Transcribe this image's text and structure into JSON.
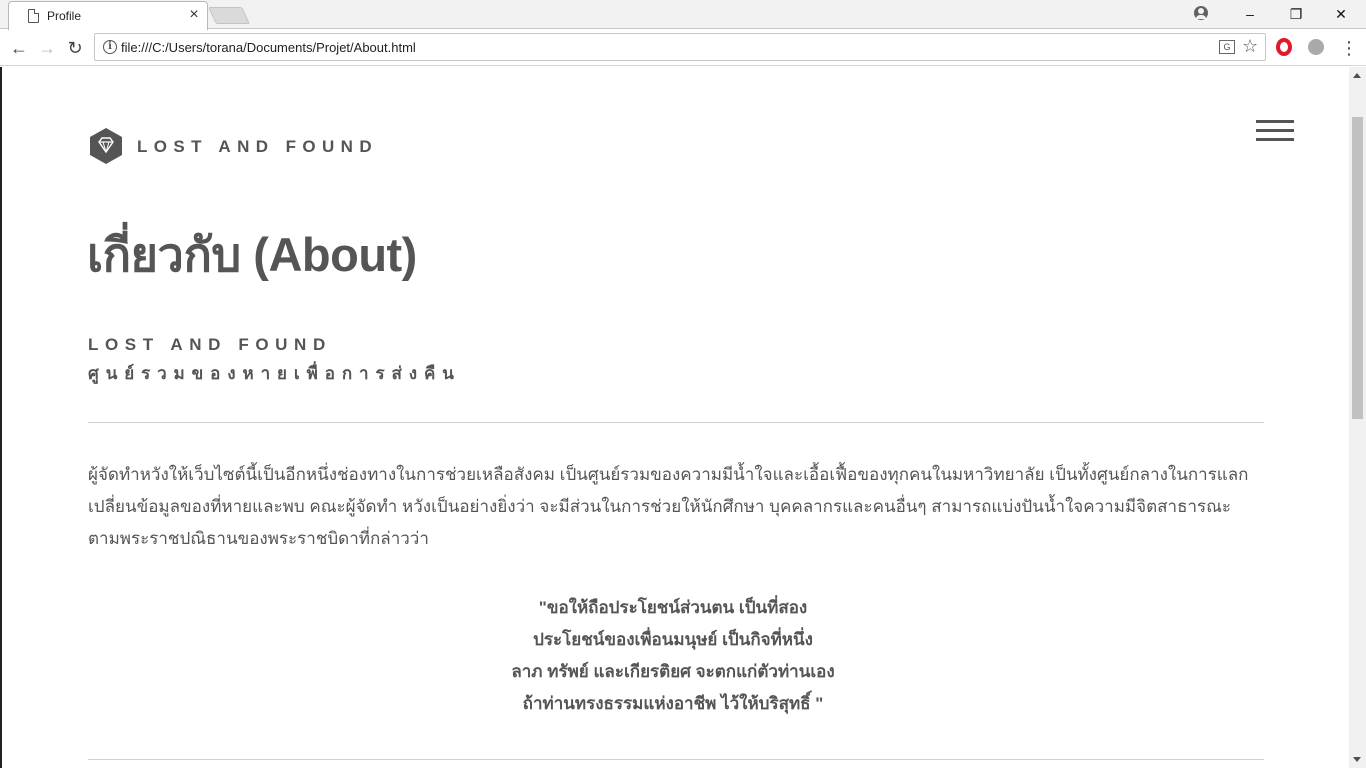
{
  "browser": {
    "tab_title": "Profile",
    "tab_close": "×",
    "url": "file:///C:/Users/torana/Documents/Projet/About.html",
    "window_controls": {
      "minimize": "–",
      "maximize": "❐",
      "close": "✕"
    },
    "nav": {
      "back": "←",
      "forward": "→",
      "reload": "↻"
    }
  },
  "site": {
    "brand_name": "LOST AND FOUND",
    "page_title": "เกี่ยวกับ (About)",
    "sub_title": "LOST AND FOUND",
    "sub_tagline": "ศูนย์รวมของหายเพื่อการส่งคืน",
    "paragraph": "ผู้จัดทำหวังให้เว็บไซต์นี้เป็นอีกหนึ่งช่องทางในการช่วยเหลือสังคม เป็นศูนย์รวมของความมีน้ำใจและเอื้อเฟื้อของทุกคนในมหาวิทยาลัย เป็นทั้งศูนย์กลางในการแลกเปลี่ยนข้อมูลของที่หายและพบ คณะผู้จัดทำ หวังเป็นอย่างยิ่งว่า จะมีส่วนในการช่วยให้นักศึกษา บุคคลากรและคนอื่นๆ สามารถแบ่งปันน้ำใจความมีจิตสาธารณะตามพระราชปณิธานของพระราชบิดาที่กล่าวว่า",
    "quote": [
      "\"ขอให้ถือประโยชน์ส่วนตน เป็นที่สอง",
      "ประโยชน์ของเพื่อนมนุษย์ เป็นกิจที่หนึ่ง",
      "ลาภ ทรัพย์ และเกียรติยศ จะตกแก่ตัวท่านเอง",
      "ถ้าท่านทรงธรรมแห่งอาชีพ ไว้ให้บริสุทธิ์ \""
    ]
  },
  "colors": {
    "text": "#555555",
    "divider": "#d0d0d0",
    "opera": "#e0192c"
  },
  "icons": [
    "page-icon",
    "close-icon",
    "profile-icon",
    "back-icon",
    "forward-icon",
    "reload-icon",
    "info-icon",
    "translate-icon",
    "star-icon",
    "opera-icon",
    "extension-icon",
    "menu-icon",
    "gem-icon",
    "hamburger-icon"
  ]
}
